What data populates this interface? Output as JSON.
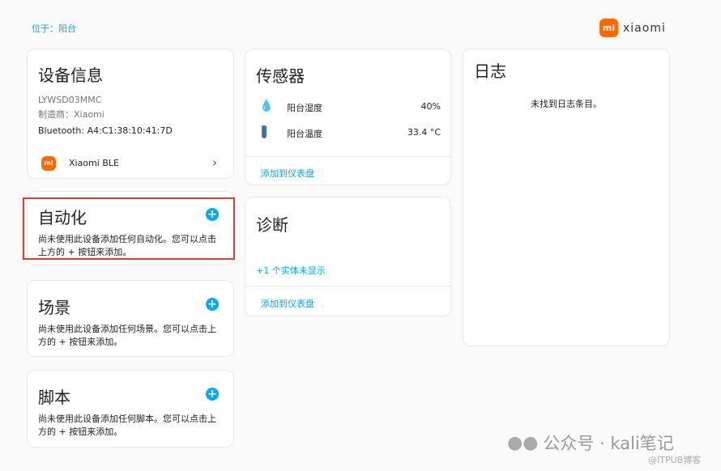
{
  "header": {
    "location": "位于：阳台",
    "brand": "xiaomi",
    "brand_logo": "mi"
  },
  "device_info": {
    "title": "设备信息",
    "model": "LYWSD03MMC",
    "manufacturer": "制造商：Xiaomi",
    "bluetooth": "Bluetooth: A4:C1:38:10:41:7D",
    "integration": "Xiaomi BLE"
  },
  "automation": {
    "title": "自动化",
    "desc": "尚未使用此设备添加任何自动化。您可以点击上方的 + 按钮来添加。"
  },
  "scene": {
    "title": "场景",
    "desc": "尚未使用此设备添加任何场景。您可以点击上方的 + 按钮来添加。"
  },
  "script": {
    "title": "脚本",
    "desc": "尚未使用此设备添加任何脚本。您可以点击上方的 + 按钮来添加。"
  },
  "sensors": {
    "title": "传感器",
    "items": [
      {
        "name": "阳台湿度",
        "value": "40%",
        "icon": "water-percent-icon"
      },
      {
        "name": "阳台温度",
        "value": "33.4 °C",
        "icon": "thermometer-icon"
      }
    ],
    "add": "添加到仪表盘"
  },
  "diagnostics": {
    "title": "诊断",
    "hidden": "+1 个实体未显示",
    "add": "添加到仪表盘"
  },
  "log": {
    "title": "日志",
    "empty": "未找到日志条目。"
  },
  "watermark": {
    "text": "公众号 · kali笔记",
    "sub": "@ITPUB博客"
  },
  "colors": {
    "accent": "#03a9f4",
    "brand": "#ff6900",
    "highlight": "#e53935"
  }
}
